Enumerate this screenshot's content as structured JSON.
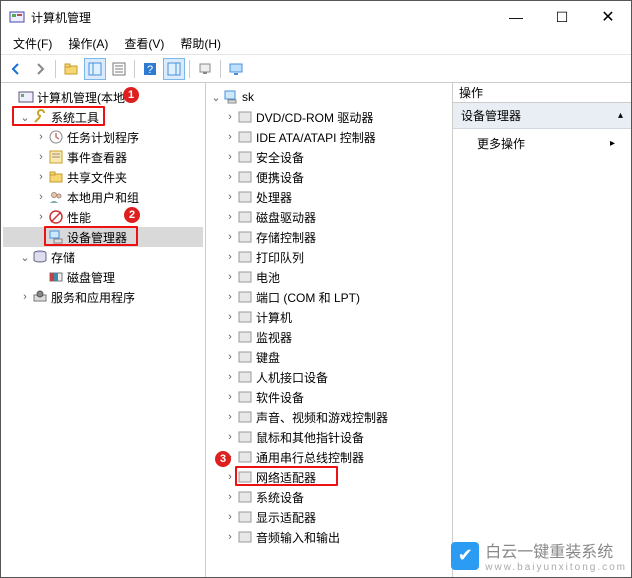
{
  "window_title": "计算机管理",
  "menubar": [
    "文件(F)",
    "操作(A)",
    "查看(V)",
    "帮助(H)"
  ],
  "left_tree": [
    {
      "indent": 0,
      "toggle": "",
      "icon": "computer-mgmt-icon",
      "label": "计算机管理(本地"
    },
    {
      "indent": 1,
      "toggle": "v",
      "icon": "tools-icon",
      "label": "系统工具"
    },
    {
      "indent": 2,
      "toggle": ">",
      "icon": "task-sched-icon",
      "label": "任务计划程序"
    },
    {
      "indent": 2,
      "toggle": ">",
      "icon": "event-viewer-icon",
      "label": "事件查看器"
    },
    {
      "indent": 2,
      "toggle": ">",
      "icon": "shared-folders-icon",
      "label": "共享文件夹"
    },
    {
      "indent": 2,
      "toggle": ">",
      "icon": "users-groups-icon",
      "label": "本地用户和组"
    },
    {
      "indent": 2,
      "toggle": ">",
      "icon": "perf-icon",
      "label": "性能"
    },
    {
      "indent": 2,
      "toggle": "",
      "icon": "device-mgr-icon",
      "label": "设备管理器",
      "selected": true
    },
    {
      "indent": 1,
      "toggle": "v",
      "icon": "storage-icon",
      "label": "存储"
    },
    {
      "indent": 2,
      "toggle": "",
      "icon": "disk-mgmt-icon",
      "label": "磁盘管理"
    },
    {
      "indent": 1,
      "toggle": ">",
      "icon": "services-apps-icon",
      "label": "服务和应用程序"
    }
  ],
  "mid_root": {
    "toggle": "v",
    "icon": "pc-icon",
    "label": "sk"
  },
  "mid_items": [
    {
      "icon": "dvd-icon",
      "label": "DVD/CD-ROM 驱动器"
    },
    {
      "icon": "ide-icon",
      "label": "IDE ATA/ATAPI 控制器"
    },
    {
      "icon": "security-icon",
      "label": "安全设备"
    },
    {
      "icon": "portable-icon",
      "label": "便携设备"
    },
    {
      "icon": "cpu-icon",
      "label": "处理器"
    },
    {
      "icon": "disk-icon",
      "label": "磁盘驱动器"
    },
    {
      "icon": "storage-ctl-icon",
      "label": "存储控制器"
    },
    {
      "icon": "printq-icon",
      "label": "打印队列"
    },
    {
      "icon": "battery-icon",
      "label": "电池"
    },
    {
      "icon": "ports-icon",
      "label": "端口 (COM 和 LPT)"
    },
    {
      "icon": "computer-cat-icon",
      "label": "计算机"
    },
    {
      "icon": "monitor-icon",
      "label": "监视器"
    },
    {
      "icon": "keyboard-icon",
      "label": "键盘"
    },
    {
      "icon": "hid-icon",
      "label": "人机接口设备"
    },
    {
      "icon": "software-dev-icon",
      "label": "软件设备"
    },
    {
      "icon": "svg-icon",
      "label": "声音、视频和游戏控制器"
    },
    {
      "icon": "mouse-icon",
      "label": "鼠标和其他指针设备"
    },
    {
      "icon": "usb-icon",
      "label": "通用串行总线控制器"
    },
    {
      "icon": "net-adapter-icon",
      "label": "网络适配器",
      "marked": true
    },
    {
      "icon": "system-dev-icon",
      "label": "系统设备"
    },
    {
      "icon": "display-ad-icon",
      "label": "显示适配器"
    },
    {
      "icon": "audio-io-icon",
      "label": "音频输入和输出"
    }
  ],
  "actions": {
    "header": "操作",
    "group_title": "设备管理器",
    "item1": "更多操作"
  },
  "annotations": {
    "badge1": "1",
    "badge2": "2",
    "badge3": "3"
  },
  "watermark": {
    "brand": "白云一键重装系统",
    "domain": "www.baiyunxitong.com"
  }
}
